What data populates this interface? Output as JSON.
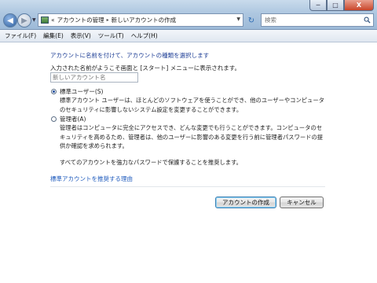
{
  "window": {
    "controls": {
      "minimize": "─",
      "maximize": "□",
      "close": "X"
    }
  },
  "nav": {
    "back_icon": "◀",
    "forward_icon": "▶",
    "dropdown_icon": "▼",
    "refresh_icon": "↻"
  },
  "address": {
    "prefix": "«",
    "crumbs": [
      "アカウントの管理",
      "新しいアカウントの作成"
    ],
    "separator": "▸"
  },
  "search": {
    "placeholder": "検索"
  },
  "menu": {
    "items": [
      "ファイル(F)",
      "編集(E)",
      "表示(V)",
      "ツール(T)",
      "ヘルプ(H)"
    ]
  },
  "main": {
    "heading": "アカウントに名前を付けて、アカウントの種類を選択します",
    "prompt": "入力された名前がようこそ画面と [スタート] メニューに表示されます。",
    "name_placeholder": "新しいアカウント名",
    "standard": {
      "label": "標準ユーザー(S)",
      "selected": true,
      "description": "標準アカウント ユーザーは、ほとんどのソフトウェアを使うことができ、他のユーザーやコンピュータのセキュリティに影響しないシステム設定を変更することができます。"
    },
    "admin": {
      "label": "管理者(A)",
      "selected": false,
      "description": "管理者はコンピュータに完全にアクセスでき、どんな変更でも行うことができます。コンピュータのセキュリティを高めるため、管理者は、他のユーザーに影響のある変更を行う前に管理者パスワードの提供か確認を求められます。"
    },
    "recommendation": "すべてのアカウントを強力なパスワードで保護することを推奨します。",
    "why_link": "標準アカウントを推奨する理由"
  },
  "buttons": {
    "create": "アカウントの作成",
    "cancel": "キャンセル"
  },
  "colors": {
    "heading": "#1f3f96",
    "link": "#1f5bbd",
    "chrome": "#aec7e0"
  }
}
